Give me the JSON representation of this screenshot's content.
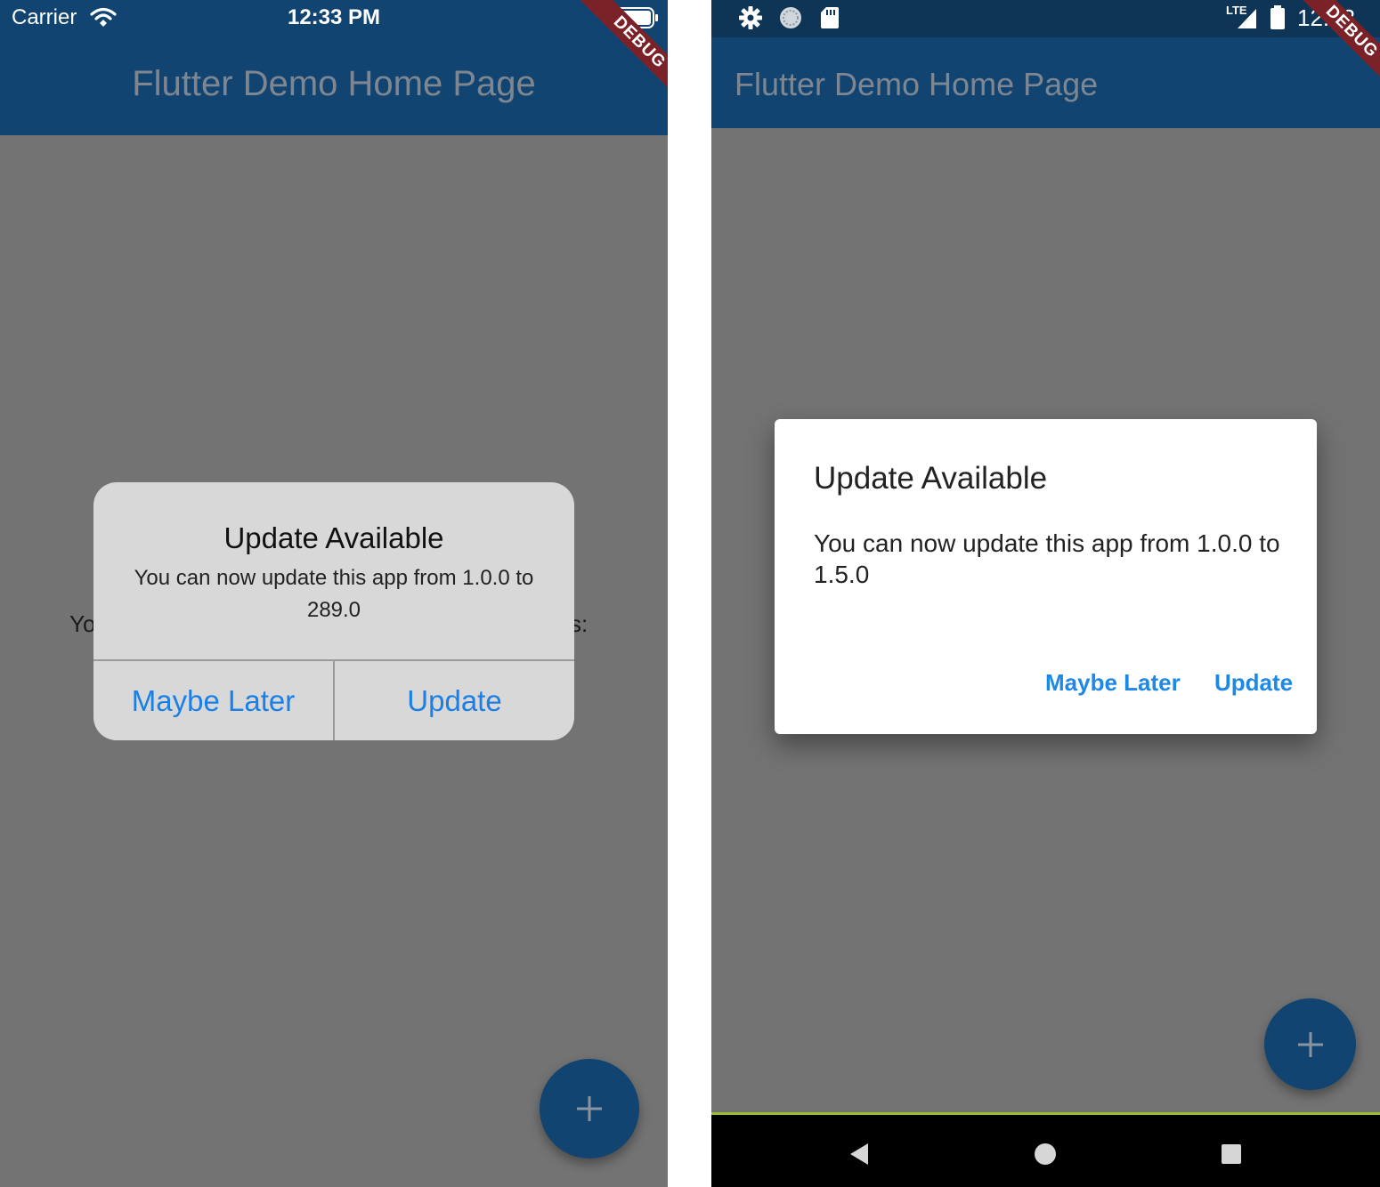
{
  "ios": {
    "status_bar": {
      "carrier": "Carrier",
      "time": "12:33 PM"
    },
    "app_bar": {
      "title": "Flutter Demo Home Page"
    },
    "debug_banner": "DEBUG",
    "background_text": {
      "left_fragment": "Yo",
      "right_fragment": "s:"
    },
    "dialog": {
      "title": "Update Available",
      "message": "You can now update this app from 1.0.0 to 289.0",
      "buttons": {
        "maybe_later": "Maybe Later",
        "update": "Update"
      }
    },
    "fab": {
      "icon": "plus-icon",
      "symbol": "+"
    }
  },
  "android": {
    "status_bar": {
      "network": "LTE",
      "time": "12:33"
    },
    "app_bar": {
      "title": "Flutter Demo Home Page"
    },
    "debug_banner": "DEBUG",
    "dialog": {
      "title": "Update Available",
      "message": "You can now update this app from 1.0.0 to 1.5.0",
      "buttons": {
        "maybe_later": "Maybe Later",
        "update": "Update"
      }
    },
    "fab": {
      "icon": "plus-icon",
      "symbol": "+"
    },
    "nav_bar": {
      "icons": [
        "back-icon",
        "home-icon",
        "recents-icon"
      ]
    }
  },
  "colors": {
    "app_bar": "#114470",
    "scrim_background": "#737373",
    "ios_dialog": "#d8d8d8",
    "ios_button_text": "#1a7fe6",
    "android_button_text": "#1e88e5",
    "debug_banner": "#7a2228"
  }
}
